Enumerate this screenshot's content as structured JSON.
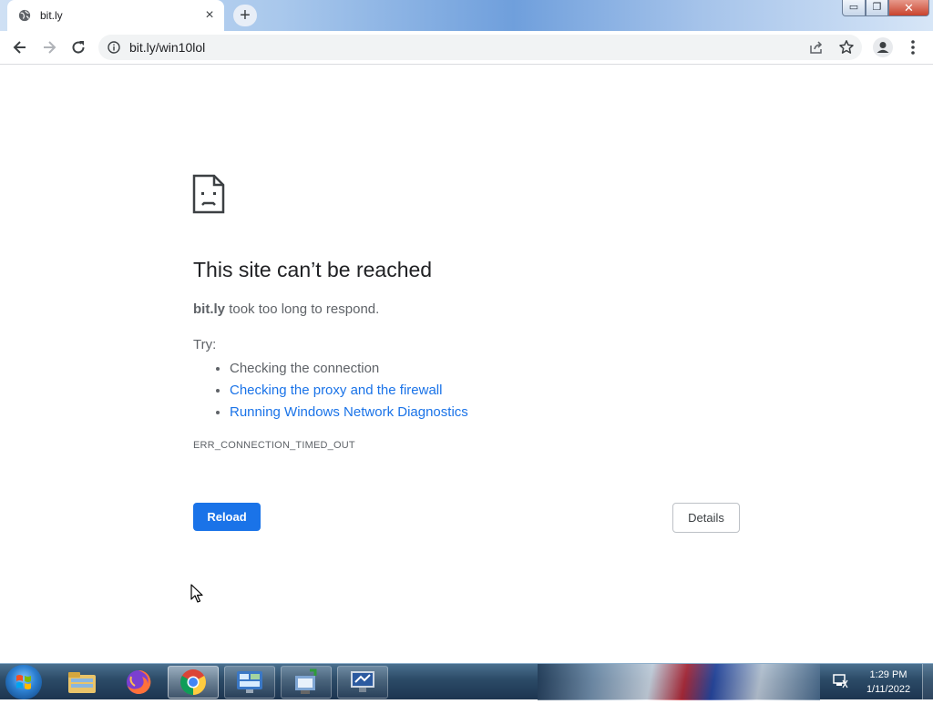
{
  "browser": {
    "tab": {
      "title": "bit.ly",
      "favicon": "globe-icon",
      "close": "×"
    },
    "new_tab": "+",
    "window_controls": {
      "minimize": "▭",
      "maximize": "❐",
      "close": "✕"
    },
    "toolbar": {
      "back": "back-arrow-icon",
      "forward": "forward-arrow-icon",
      "reload": "reload-icon",
      "url": "bit.ly/win10lol",
      "security_icon": "info-icon",
      "share": "share-icon",
      "bookmark": "star-icon",
      "profile": "profile-icon",
      "menu": "kebab-menu-icon"
    }
  },
  "error_page": {
    "title": "This site can’t be reached",
    "host": "bit.ly",
    "description": "took too long to respond.",
    "try_label": "Try:",
    "suggestions": [
      {
        "text": "Checking the connection"
      },
      {
        "text": "Checking the proxy and the firewall"
      },
      {
        "text": "Running Windows Network Diagnostics"
      }
    ],
    "error_code": "ERR_CONNECTION_TIMED_OUT",
    "reload_label": "Reload",
    "details_label": "Details"
  },
  "taskbar": {
    "start": "windows-start-orb",
    "apps": [
      "file-explorer-icon",
      "firefox-icon",
      "chrome-icon",
      "control-panel-icon",
      "network-icon",
      "remote-desktop-icon"
    ],
    "clock_time": "1:29 PM",
    "clock_date": "1/11/2022"
  },
  "colors": {
    "accent": "#1a73e8",
    "text_primary": "#202124",
    "text_secondary": "#5f6368"
  }
}
